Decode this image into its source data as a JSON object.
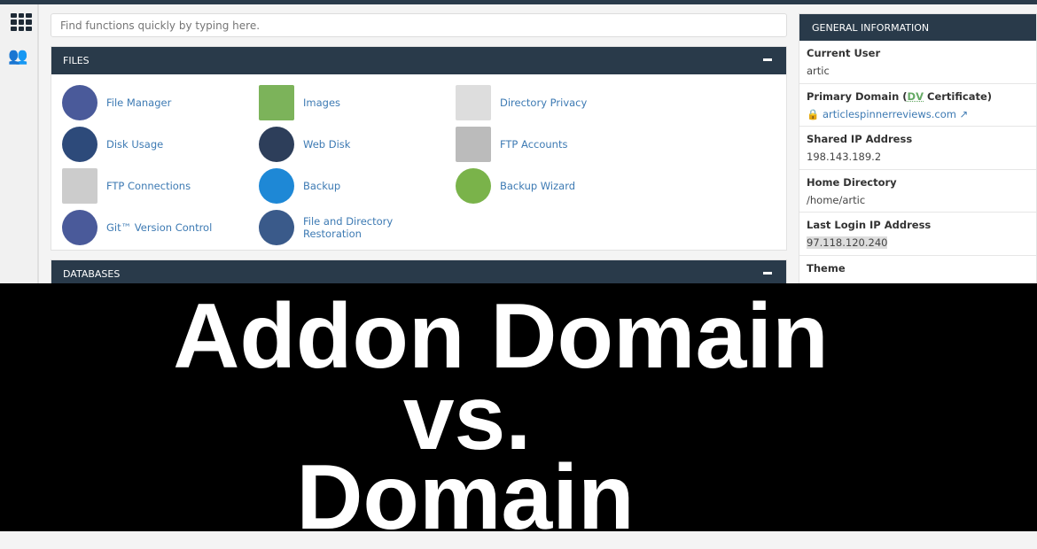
{
  "search": {
    "placeholder": "Find functions quickly by typing here."
  },
  "files": {
    "title": "FILES",
    "items": [
      {
        "label": "File Manager",
        "icon": "file-manager-icon"
      },
      {
        "label": "Images",
        "icon": "images-icon"
      },
      {
        "label": "Directory Privacy",
        "icon": "directory-privacy-icon"
      },
      {
        "label": "Disk Usage",
        "icon": "disk-usage-icon"
      },
      {
        "label": "Web Disk",
        "icon": "web-disk-icon"
      },
      {
        "label": "FTP Accounts",
        "icon": "ftp-accounts-icon"
      },
      {
        "label": "FTP Connections",
        "icon": "ftp-connections-icon"
      },
      {
        "label": "Backup",
        "icon": "backup-icon"
      },
      {
        "label": "Backup Wizard",
        "icon": "backup-wizard-icon"
      },
      {
        "label": "Git™ Version Control",
        "icon": "git-icon"
      },
      {
        "label": "File and Directory Restoration",
        "icon": "restoration-icon"
      }
    ]
  },
  "databases": {
    "title": "DATABASES"
  },
  "general": {
    "title": "GENERAL INFORMATION",
    "current_user_label": "Current User",
    "current_user": "artic",
    "primary_domain_label": "Primary Domain (",
    "dv": "DV",
    "cert": " Certificate)",
    "primary_domain": "articlespinnerreviews.com",
    "shared_ip_label": "Shared IP Address",
    "shared_ip": "198.143.189.2",
    "home_label": "Home Directory",
    "home": "/home/artic",
    "last_login_label": "Last Login IP Address",
    "last_login": "97.118.120.240",
    "theme_label": "Theme"
  },
  "banner": {
    "line1": "Addon Domain",
    "line2": "vs.",
    "line3": "Domain"
  },
  "colors": {
    "header": "#293a4a",
    "link": "#3d7ab3"
  }
}
